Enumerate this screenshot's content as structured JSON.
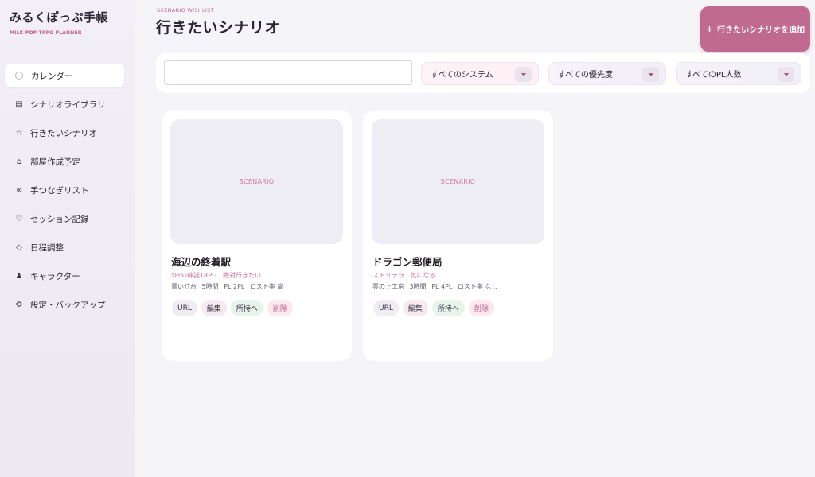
{
  "app": {
    "title": "みるくぽっぷ手帳",
    "subtitle": "MILK POP TRPG PLANNER"
  },
  "sidebar": {
    "items": [
      {
        "label": "カレンダー",
        "icon": "circle-icon",
        "active": true
      },
      {
        "label": "シナリオライブラリ",
        "icon": "book-icon",
        "glyph": "▤"
      },
      {
        "label": "行きたいシナリオ",
        "icon": "star-icon",
        "glyph": "☆"
      },
      {
        "label": "部屋作成予定",
        "icon": "house-icon",
        "glyph": "⌂"
      },
      {
        "label": "手つなぎリスト",
        "icon": "infinity-icon",
        "glyph": "∞"
      },
      {
        "label": "セッション記録",
        "icon": "heart-icon",
        "glyph": "♡"
      },
      {
        "label": "日程調整",
        "icon": "diamond-icon",
        "glyph": "◇"
      },
      {
        "label": "キャラクター",
        "icon": "person-icon",
        "glyph": "♟"
      },
      {
        "label": "設定・バックアップ",
        "icon": "gear-icon",
        "glyph": "⚙"
      }
    ]
  },
  "header": {
    "eyebrow": "SCENARIO WISHLIST",
    "title": "行きたいシナリオ",
    "add_button": "行きたいシナリオを追加",
    "add_button_icon": "+"
  },
  "filters": {
    "search_value": "",
    "system": "すべてのシステム",
    "priority": "すべての優先度",
    "players": "すべてのPL人数"
  },
  "cards": [
    {
      "thumb_label": "SCENARIO",
      "title": "海辺の終着駅",
      "system": "ｸﾄｩﾙﾌ神話TRPG",
      "priority": "絶対行きたい",
      "author": "青い灯台",
      "duration": "5時間",
      "players": "PL 2PL",
      "lost_rate": "ロスト率 高"
    },
    {
      "thumb_label": "SCENARIO",
      "title": "ドラゴン郵便局",
      "system": "ストリテラ",
      "priority": "気になる",
      "author": "雲の上工房",
      "duration": "3時間",
      "players": "PL 4PL",
      "lost_rate": "ロスト率 なし"
    }
  ],
  "card_actions": {
    "url": "URL",
    "edit": "編集",
    "move": "所持へ",
    "delete": "削除"
  },
  "colors": {
    "accent": "#c06a90",
    "tag_pink": "#cf6f97"
  }
}
